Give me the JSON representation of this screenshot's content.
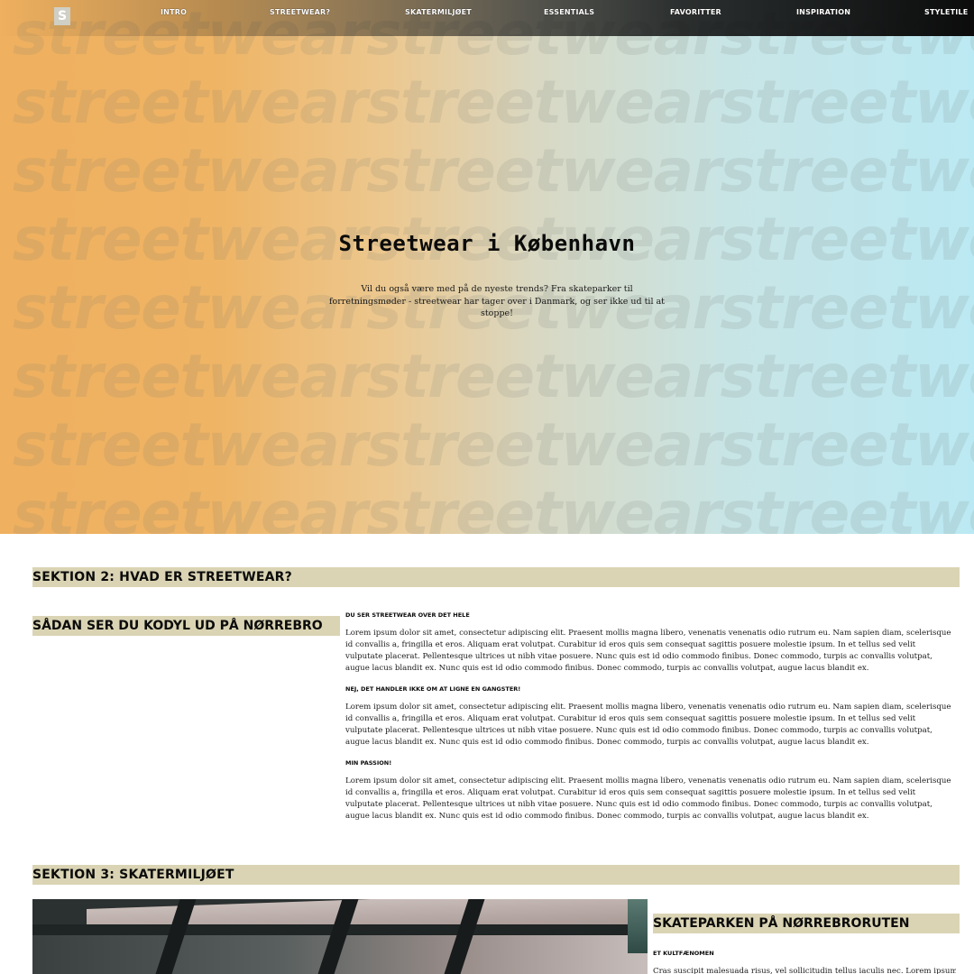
{
  "nav": {
    "logo": "S",
    "items": [
      "Intro",
      "Streetwear?",
      "Skatermiljøet",
      "Essentials",
      "Favoritter",
      "Inspiration",
      "Styletile"
    ]
  },
  "hero": {
    "watermark": "streetwearstreetwearstreetwear",
    "title": "Streetwear i København",
    "text": "Vil du også være med på de nyeste trends? Fra skateparker til forretningsmøder - streetwear har tager over i Danmark, og ser ikke ud til at stoppe!"
  },
  "section2": {
    "title": "Sektion 2: Hvad er streetwear?",
    "subtitle": "Sådan ser du kodyl ud på Nørrebro",
    "blocks": [
      {
        "heading": "Du ser streetwear over det hele",
        "text": "Lorem ipsum dolor sit amet, consectetur adipiscing elit. Praesent mollis magna libero, venenatis venenatis odio rutrum eu. Nam sapien diam, scelerisque id convallis a, fringilla et eros. Aliquam erat volutpat. Curabitur id eros quis sem consequat sagittis posuere molestie ipsum. In et tellus sed velit vulputate placerat. Pellentesque ultrices ut nibh vitae posuere. Nunc quis est id odio commodo finibus. Donec commodo, turpis ac convallis volutpat, augue lacus blandit ex. Nunc quis est id odio commodo finibus. Donec commodo, turpis ac convallis volutpat, augue lacus blandit ex."
      },
      {
        "heading": "Nej, det handler ikke om at ligne en gangster!",
        "text": "Lorem ipsum dolor sit amet, consectetur adipiscing elit. Praesent mollis magna libero, venenatis venenatis odio rutrum eu. Nam sapien diam, scelerisque id convallis a, fringilla et eros. Aliquam erat volutpat. Curabitur id eros quis sem consequat sagittis posuere molestie ipsum. In et tellus sed velit vulputate placerat. Pellentesque ultrices ut nibh vitae posuere. Nunc quis est id odio commodo finibus. Donec commodo, turpis ac convallis volutpat, augue lacus blandit ex. Nunc quis est id odio commodo finibus. Donec commodo, turpis ac convallis volutpat, augue lacus blandit ex."
      },
      {
        "heading": "Min passion!",
        "text": "Lorem ipsum dolor sit amet, consectetur adipiscing elit. Praesent mollis magna libero, venenatis venenatis odio rutrum eu. Nam sapien diam, scelerisque id convallis a, fringilla et eros. Aliquam erat volutpat. Curabitur id eros quis sem consequat sagittis posuere molestie ipsum. In et tellus sed velit vulputate placerat. Pellentesque ultrices ut nibh vitae posuere. Nunc quis est id odio commodo finibus. Donec commodo, turpis ac convallis volutpat, augue lacus blandit ex. Nunc quis est id odio commodo finibus. Donec commodo, turpis ac convallis volutpat, augue lacus blandit ex."
      }
    ]
  },
  "section3": {
    "title": "Sektion 3: Skatermiljøet",
    "subtitle": "Skateparken på Nørrebroruten",
    "heading": "Et kultfænomen",
    "text": "Cras suscipit malesuada risus, vel sollicitudin tellus iaculis nec. Lorem ipsum dolor sit"
  },
  "colors": {
    "hero_left": "#efb05f",
    "hero_right": "#bbe9f3",
    "section_bar": "#dad4b4",
    "nav_dark": "#0c0c0c"
  }
}
